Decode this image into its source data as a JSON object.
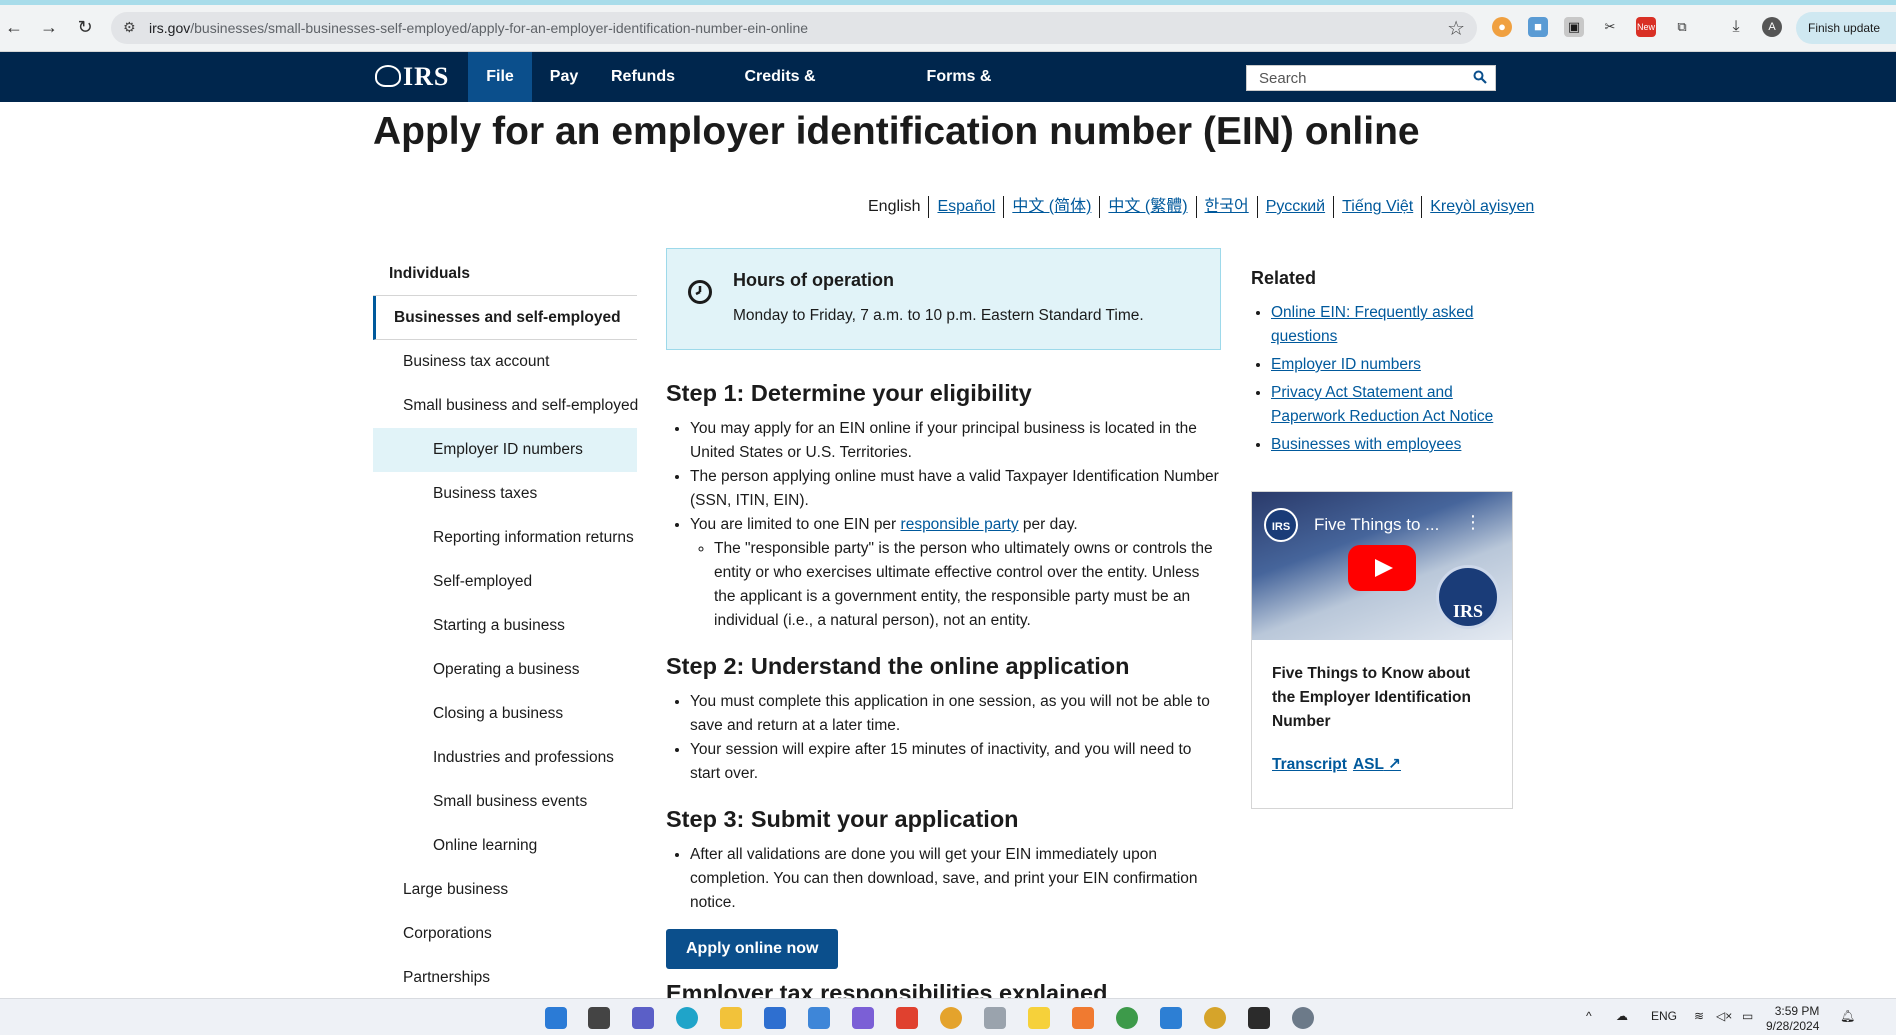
{
  "browser": {
    "url_domain": "irs.gov",
    "url_path": "/businesses/small-businesses-self-employed/apply-for-an-employer-identification-number-ein-online",
    "finish_update_label": "Finish update",
    "profile_initial": "A",
    "new_badge": "New"
  },
  "header": {
    "logo_text": "IRS",
    "nav": [
      "File",
      "Pay",
      "Refunds",
      "Credits & Deductions",
      "Forms & Instructions"
    ],
    "search_placeholder": "Search"
  },
  "page": {
    "title": "Apply for an employer identification number (EIN) online"
  },
  "languages": [
    {
      "label": "English",
      "link": false
    },
    {
      "label": "Español",
      "link": true
    },
    {
      "label": "中文 (简体)",
      "link": true
    },
    {
      "label": "中文 (繁體)",
      "link": true
    },
    {
      "label": "한국어",
      "link": true
    },
    {
      "label": "Русский",
      "link": true
    },
    {
      "label": "Tiếng Việt",
      "link": true
    },
    {
      "label": "Kreyòl ayisyen",
      "link": true
    }
  ],
  "sidebar": {
    "items": [
      {
        "label": "Individuals",
        "level": 0
      },
      {
        "label": "Businesses and self-employed",
        "level": 0,
        "active": true
      },
      {
        "label": "Business tax account",
        "level": 1
      },
      {
        "label": "Small business and self-employed",
        "level": 1
      },
      {
        "label": "Employer ID numbers",
        "level": 2,
        "current": true
      },
      {
        "label": "Business taxes",
        "level": 2
      },
      {
        "label": "Reporting information returns",
        "level": 2
      },
      {
        "label": "Self-employed",
        "level": 2
      },
      {
        "label": "Starting a business",
        "level": 2
      },
      {
        "label": "Operating a business",
        "level": 2
      },
      {
        "label": "Closing a business",
        "level": 2
      },
      {
        "label": "Industries and professions",
        "level": 2
      },
      {
        "label": "Small business events",
        "level": 2
      },
      {
        "label": "Online learning",
        "level": 2
      },
      {
        "label": "Large business",
        "level": 1
      },
      {
        "label": "Corporations",
        "level": 1
      },
      {
        "label": "Partnerships",
        "level": 1
      }
    ]
  },
  "hours": {
    "title": "Hours of operation",
    "text": "Monday to Friday, 7 a.m. to 10 p.m. Eastern Standard Time."
  },
  "step1": {
    "heading": "Step 1: Determine your eligibility",
    "b1": "You may apply for an EIN online if your principal business is located in the United States or U.S. Territories.",
    "b2": "The person applying online must have a valid Taxpayer Identification Number (SSN, ITIN, EIN).",
    "b3_pre": "You are limited to one EIN per ",
    "b3_link": "responsible party",
    "b3_post": " per day.",
    "sub1": "The \"responsible party\" is the person who ultimately owns or controls the entity or who exercises ultimate effective control over the entity. Unless the applicant is a government entity, the responsible party must be an individual (i.e., a natural person), not an entity."
  },
  "step2": {
    "heading": "Step 2: Understand the online application",
    "b1": "You must complete this application in one session, as you will not be able to save and return at a later time.",
    "b2": "Your session will expire after 15 minutes of inactivity, and you will need to start over."
  },
  "step3": {
    "heading": "Step 3: Submit your application",
    "b1": "After all validations are done you will get your EIN immediately upon completion. You can then download, save, and print your EIN confirmation notice.",
    "button": "Apply online now"
  },
  "next_heading": "Employer tax responsibilities explained",
  "related": {
    "title": "Related",
    "links": [
      "Online EIN: Frequently asked questions",
      "Employer ID numbers",
      "Privacy Act Statement and Paperwork Reduction Act Notice",
      "Businesses with employees"
    ]
  },
  "video": {
    "thumb_title": "Five Things to ...",
    "thumb_logo": "IRS",
    "caption": "Five Things to Know about the Employer Identification Number",
    "transcript": "Transcript",
    "asl": "ASL"
  },
  "taskbar": {
    "lang": "ENG",
    "time": "3:59 PM",
    "date": "9/28/2024"
  }
}
